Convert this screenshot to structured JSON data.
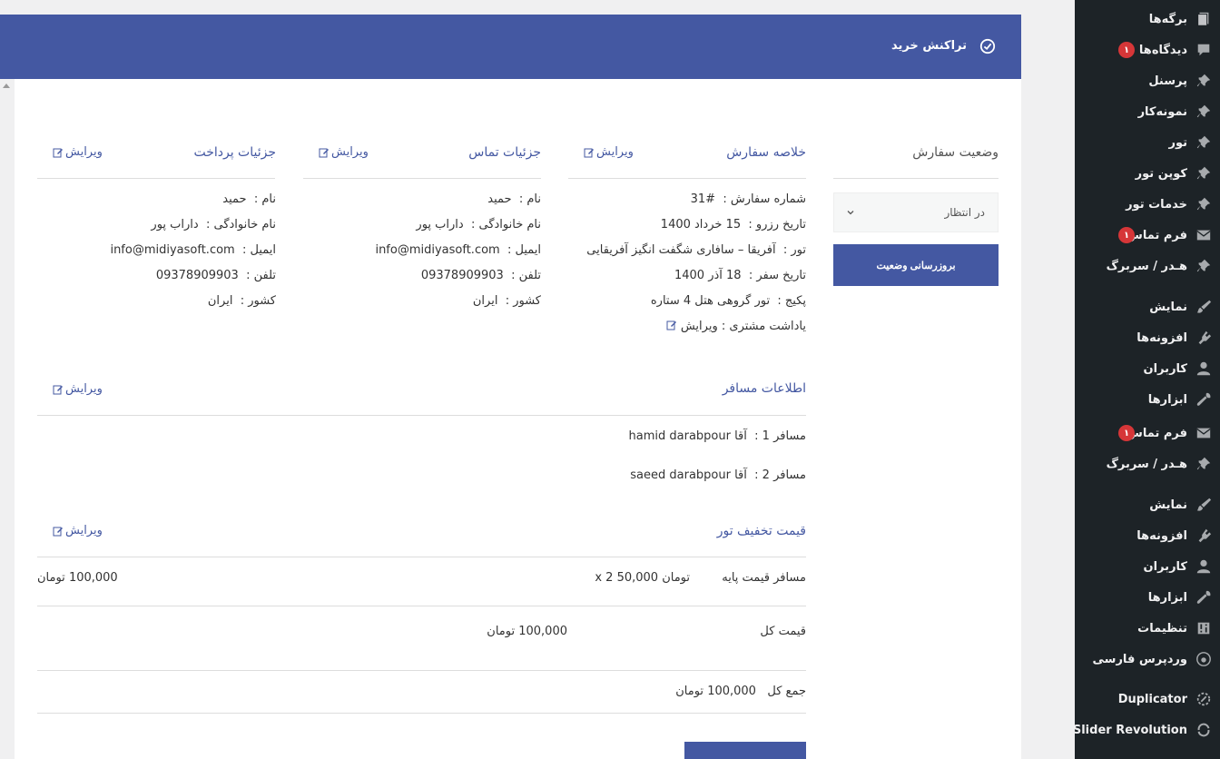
{
  "sidebar": {
    "items": [
      {
        "label": "برگه‌ها",
        "icon": "pages-icon"
      },
      {
        "label": "دیدگاه‌ها",
        "icon": "comments-icon",
        "badge": "۱"
      },
      {
        "label": "پرسنل",
        "icon": "pin-icon"
      },
      {
        "label": "نمونه‌کار",
        "icon": "pin-icon"
      },
      {
        "label": "تور",
        "icon": "pin-icon"
      },
      {
        "label": "کوپن تور",
        "icon": "pin-icon"
      },
      {
        "label": "خدمات تور",
        "icon": "pin-icon"
      },
      {
        "label": "فرم تماس",
        "icon": "mail-icon",
        "badge": "۱"
      },
      {
        "label": "هـدر / سربرگ",
        "icon": "pin-icon"
      },
      {
        "label": "نمایش",
        "icon": "brush-icon"
      },
      {
        "label": "افزونه‌ها",
        "icon": "plugin-icon"
      },
      {
        "label": "کاربران",
        "icon": "user-icon"
      },
      {
        "label": "ابزارها",
        "icon": "wrench-icon"
      },
      {
        "label": "فرم تماس",
        "icon": "mail-icon",
        "badge": "۱"
      },
      {
        "label": "هـدر / سربرگ",
        "icon": "pin-icon"
      },
      {
        "label": "نمایش",
        "icon": "brush-icon"
      },
      {
        "label": "افزونه‌ها",
        "icon": "plugin-icon"
      },
      {
        "label": "کاربران",
        "icon": "user-icon"
      },
      {
        "label": "ابزارها",
        "icon": "wrench-icon"
      },
      {
        "label": "تنظیمات",
        "icon": "settings-icon"
      },
      {
        "label": "وردپرس فارسی",
        "icon": "wp-farsi-icon"
      },
      {
        "label": "Duplicator",
        "icon": "duplicator-icon"
      },
      {
        "label": "Slider Revolution",
        "icon": "slider-icon"
      }
    ]
  },
  "header": {
    "title": "تراکنش خرید"
  },
  "status": {
    "title": "وضعیت سفارش",
    "selected": "در انتظار",
    "update_button": "بروزرسانی وضعیت"
  },
  "edit_label": "ویرایش",
  "order_summary": {
    "title": "خلاصه سفارش",
    "rows": [
      {
        "label": "شماره سفارش :",
        "value": "31#"
      },
      {
        "label": "تاریخ رزرو :",
        "value": "15 خرداد 1400"
      },
      {
        "label": "تور :",
        "value": "آفریقا – سافاری شگفت انگیز آفریقایی"
      },
      {
        "label": "تاریخ سفر :",
        "value": "18 آذر 1400"
      },
      {
        "label": "پکیج :",
        "value": "تور گروهی هتل 4 ستاره"
      },
      {
        "label": "یاداشت مشتری :",
        "value": "ویرایش"
      }
    ]
  },
  "contact_details": {
    "title": "جزئیات تماس",
    "rows": [
      {
        "label": "نام :",
        "value": "حمید"
      },
      {
        "label": "نام خانوادگی :",
        "value": "داراب پور"
      },
      {
        "label": "ایمیل :",
        "value": "info@midiyasoft.com"
      },
      {
        "label": "تلفن :",
        "value": "09378909903"
      },
      {
        "label": "کشور :",
        "value": "ایران"
      }
    ]
  },
  "payment_details": {
    "title": "جزئیات پرداخت",
    "rows": [
      {
        "label": "نام :",
        "value": "حمید"
      },
      {
        "label": "نام خانوادگی :",
        "value": "داراب پور"
      },
      {
        "label": "ایمیل :",
        "value": "info@midiyasoft.com"
      },
      {
        "label": "تلفن :",
        "value": "09378909903"
      },
      {
        "label": "کشور :",
        "value": "ایران"
      }
    ]
  },
  "traveler_info": {
    "title": "اطلاعات مسافر",
    "rows": [
      {
        "label": "مسافر 1 :",
        "value": "آقا  hamid darabpour"
      },
      {
        "label": "مسافر 2 :",
        "value": "آقا  saeed darabpour"
      }
    ]
  },
  "discount": {
    "title": "قیمت تخفیف تور",
    "line_label": "مسافر قیمت پایه",
    "line_calc": "تومان 50,000 x 2",
    "line_total": "100,000 تومان"
  },
  "totals": {
    "subtotal_label": "قیمت کل",
    "subtotal_value": "100,000 تومان",
    "grand_label": "جمع کل",
    "grand_value": "100,000 تومان"
  }
}
